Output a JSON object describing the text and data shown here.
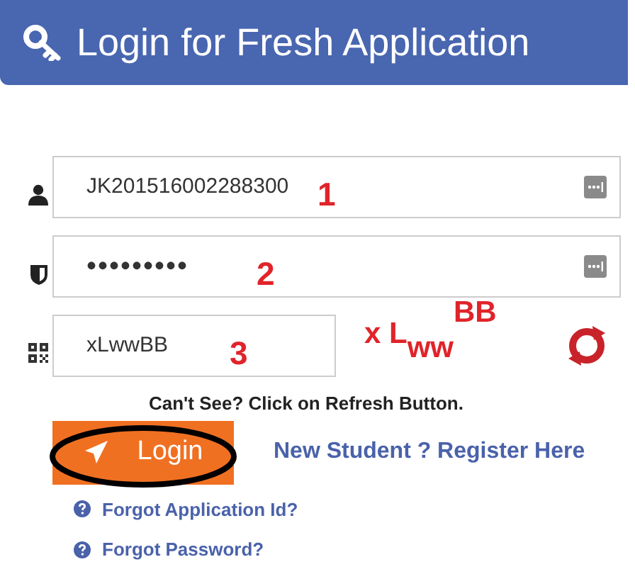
{
  "header": {
    "title": "Login for Fresh Application"
  },
  "fields": [
    {
      "kind": "text",
      "value": "JK201516002288300",
      "annotation": "1"
    },
    {
      "kind": "password",
      "value": "•••••••••",
      "annotation": "2"
    },
    {
      "kind": "captcha",
      "value": "xLwwBB",
      "annotation": "3"
    }
  ],
  "captcha_text": "x L$_{ww}$$^{BB}$",
  "hint": "Can't See? Click on Refresh Button.",
  "login_button": {
    "label": "Login",
    "circled": true
  },
  "register_link": "New Student ? Register Here",
  "help_links": [
    "Forgot Application Id?",
    "Forgot Password?"
  ]
}
